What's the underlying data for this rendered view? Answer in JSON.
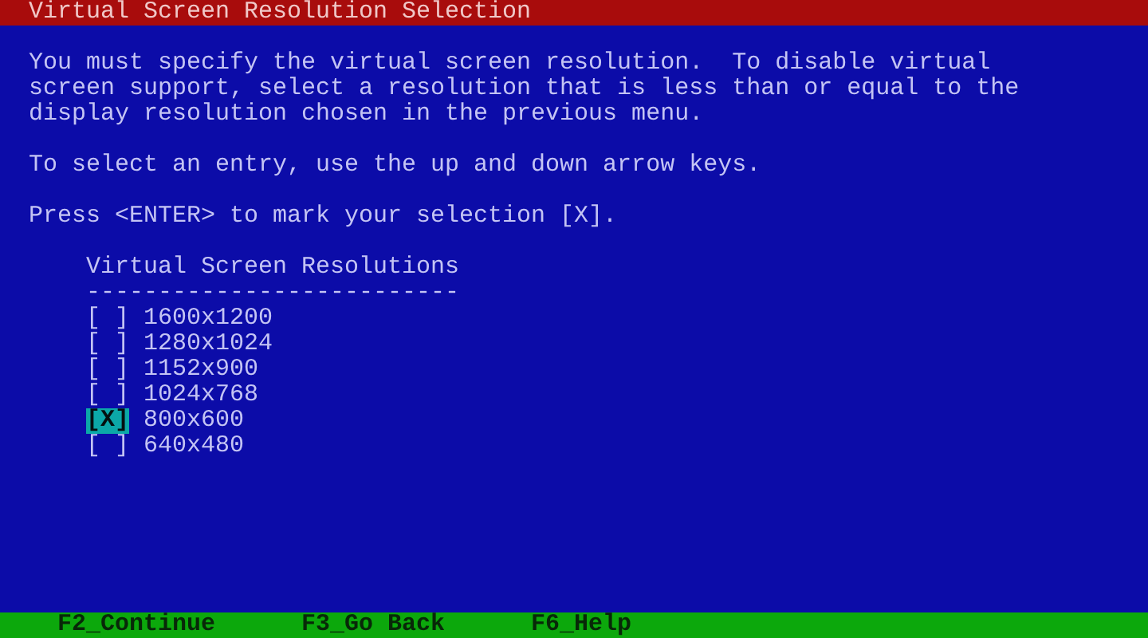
{
  "title_bar": {
    "title": "Virtual Screen Resolution Selection"
  },
  "instructions": [
    "You must specify the virtual screen resolution.  To disable virtual\nscreen support, select a resolution that is less than or equal to the\ndisplay resolution chosen in the previous menu.",
    "To select an entry, use the up and down arrow keys.",
    "Press <ENTER> to mark your selection [X]."
  ],
  "list": {
    "heading": "Virtual Screen Resolutions",
    "underline": "--------------------------",
    "options": [
      {
        "box": "[ ]",
        "label": "1600x1200",
        "selected": false
      },
      {
        "box": "[ ]",
        "label": "1280x1024",
        "selected": false
      },
      {
        "box": "[ ]",
        "label": "1152x900",
        "selected": false
      },
      {
        "box": "[ ]",
        "label": "1024x768",
        "selected": false
      },
      {
        "box": "[X]",
        "label": "800x600",
        "selected": true
      },
      {
        "box": "[ ]",
        "label": "640x480",
        "selected": false
      }
    ]
  },
  "function_keys": [
    {
      "label": "F2_Continue"
    },
    {
      "label": "F3_Go Back"
    },
    {
      "label": "F6_Help"
    }
  ]
}
